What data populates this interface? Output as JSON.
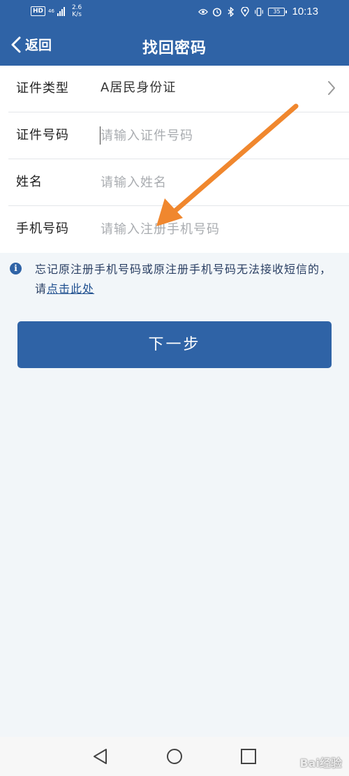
{
  "status_bar": {
    "hd": "HD",
    "network": "46",
    "speed_value": "2.6",
    "speed_unit": "K/s",
    "battery": "35",
    "time": "10:13"
  },
  "header": {
    "back_label": "返回",
    "title": "找回密码"
  },
  "form": {
    "id_type": {
      "label": "证件类型",
      "value": "A居民身份证"
    },
    "id_number": {
      "label": "证件号码",
      "placeholder": "请输入证件号码"
    },
    "name": {
      "label": "姓名",
      "placeholder": "请输入姓名"
    },
    "phone": {
      "label": "手机号码",
      "placeholder": "请输入注册手机号码"
    }
  },
  "notice": {
    "icon": "i",
    "text": "忘记原注册手机号码或原注册手机号码无法接收短信的，请",
    "link": "点击此处"
  },
  "next_button": "下一步",
  "watermark": "Bai经验",
  "colors": {
    "primary": "#2f63a6",
    "background": "#f2f6f9",
    "arrow": "#f0872e"
  }
}
